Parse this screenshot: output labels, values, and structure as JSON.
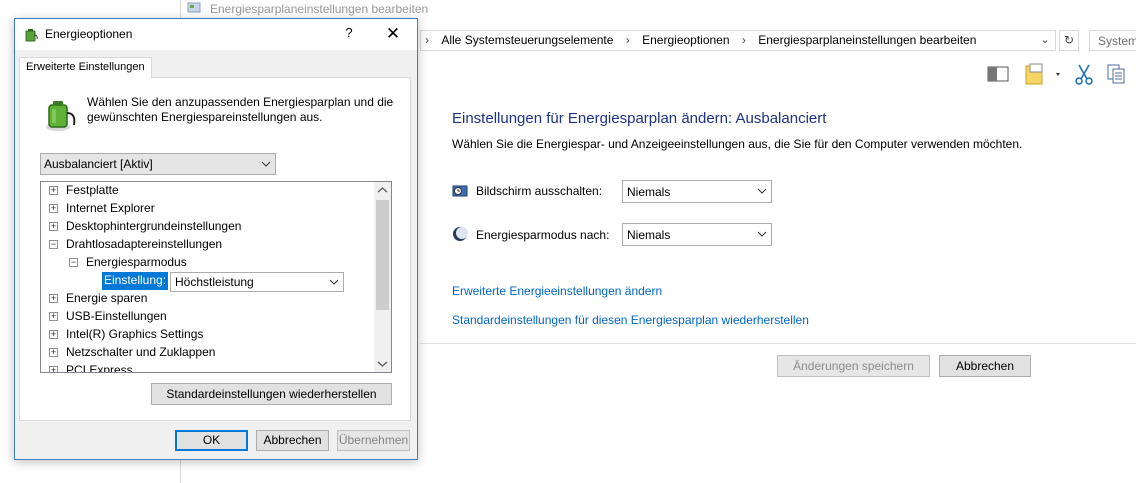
{
  "window": {
    "title": "Energiesparplaneinstellungen bearbeiten",
    "breadcrumbs": [
      "Alle Systemsteuerungselemente",
      "Energieoptionen",
      "Energiesparplaneinstellungen bearbeiten"
    ],
    "search_placeholder": "System"
  },
  "panel": {
    "heading": "Einstellungen für Energiesparplan ändern: Ausbalanciert",
    "subtitle": "Wählen Sie die Energiespar- und Anzeigeeinstellungen aus, die Sie für den Computer verwenden möchten.",
    "display_off_label": "Bildschirm ausschalten:",
    "display_off_value": "Niemals",
    "sleep_label": "Energiesparmodus nach:",
    "sleep_value": "Niemals",
    "link_advanced": "Erweiterte Energieeinstellungen ändern",
    "link_restore": "Standardeinstellungen für diesen Energiesparplan wiederherstellen",
    "save_button": "Änderungen speichern",
    "cancel_button": "Abbrechen"
  },
  "dialog": {
    "title": "Energieoptionen",
    "help": "?",
    "close": "✕",
    "tab": "Erweiterte Einstellungen",
    "intro": "Wählen Sie den anzupassenden Energiesparplan und die gewünschten Energiespareinstellungen aus.",
    "plan": "Ausbalanciert [Aktiv]",
    "tree": [
      {
        "label": "Festplatte",
        "state": "+"
      },
      {
        "label": "Internet Explorer",
        "state": "+"
      },
      {
        "label": "Desktophintergrundeinstellungen",
        "state": "+"
      },
      {
        "label": "Drahtlosadaptereinstellungen",
        "state": "−"
      },
      {
        "label": "Energiesparmodus",
        "state": "−"
      },
      {
        "label": "Energie sparen",
        "state": "+"
      },
      {
        "label": "USB-Einstellungen",
        "state": "+"
      },
      {
        "label": "Intel(R) Graphics Settings",
        "state": "+"
      },
      {
        "label": "Netzschalter und Zuklappen",
        "state": "+"
      },
      {
        "label": "PCI Express",
        "state": "+"
      }
    ],
    "setting_label": "Einstellung:",
    "setting_value": "Höchstleistung",
    "restore_button": "Standardeinstellungen wiederherstellen",
    "ok_button": "OK",
    "cancel_button": "Abbrechen",
    "apply_button": "Übernehmen"
  },
  "colors": {
    "heading": "#1e3287",
    "link": "#0066cc",
    "selection": "#0078d7",
    "dialog_border": "#3f7fc5"
  }
}
